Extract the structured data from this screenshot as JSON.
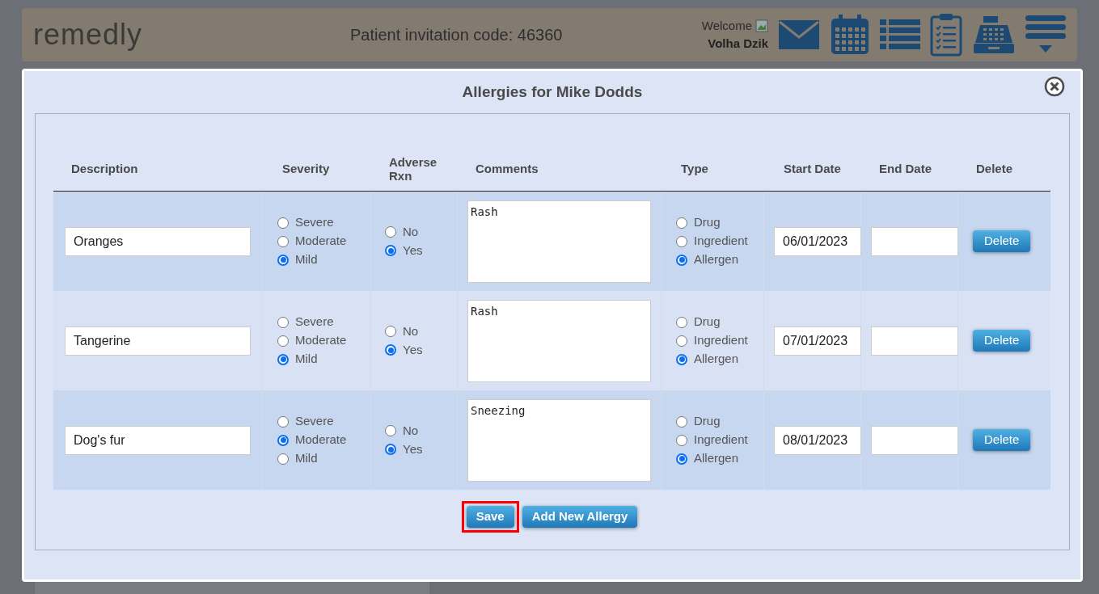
{
  "header": {
    "logo": "remedly",
    "invitation_code": "Patient invitation code: 46360",
    "welcome": "Welcome",
    "user_name": "Volha Dzik"
  },
  "modal": {
    "title": "Allergies for Mike Dodds",
    "columns": [
      "Description",
      "Severity",
      "Adverse Rxn",
      "Comments",
      "Type",
      "Start Date",
      "End Date",
      "Delete"
    ],
    "rows": [
      {
        "description": "Oranges",
        "severity": [
          {
            "label": "Severe",
            "selected": false
          },
          {
            "label": "Moderate",
            "selected": false
          },
          {
            "label": "Mild",
            "selected": true
          }
        ],
        "adverse_rxn": [
          {
            "label": "No",
            "selected": false
          },
          {
            "label": "Yes",
            "selected": true
          }
        ],
        "comments": "Rash",
        "type": [
          {
            "label": "Drug",
            "selected": false
          },
          {
            "label": "Ingredient",
            "selected": false
          },
          {
            "label": "Allergen",
            "selected": true
          }
        ],
        "start_date": "06/01/2023",
        "delete": "Delete"
      },
      {
        "description": "Tangerine",
        "severity": [
          {
            "label": "Severe",
            "selected": false
          },
          {
            "label": "Moderate",
            "selected": false
          },
          {
            "label": "Mild",
            "selected": true
          }
        ],
        "adverse_rxn": [
          {
            "label": "No",
            "selected": false
          },
          {
            "label": "Yes",
            "selected": true
          }
        ],
        "comments": "Rash",
        "type": [
          {
            "label": "Drug",
            "selected": false
          },
          {
            "label": "Ingredient",
            "selected": false
          },
          {
            "label": "Allergen",
            "selected": true
          }
        ],
        "start_date": "07/01/2023",
        "delete": "Delete"
      },
      {
        "description": "Dog's fur",
        "severity": [
          {
            "label": "Severe",
            "selected": false
          },
          {
            "label": "Moderate",
            "selected": true
          },
          {
            "label": "Mild",
            "selected": false
          }
        ],
        "adverse_rxn": [
          {
            "label": "No",
            "selected": false
          },
          {
            "label": "Yes",
            "selected": true
          }
        ],
        "comments": "Sneezing",
        "type": [
          {
            "label": "Drug",
            "selected": false
          },
          {
            "label": "Ingredient",
            "selected": false
          },
          {
            "label": "Allergen",
            "selected": true
          }
        ],
        "start_date": "08/01/2023",
        "delete": "Delete"
      }
    ],
    "buttons": [
      {
        "label": "Save",
        "highlighted": true
      },
      {
        "label": "Add New Allergy",
        "highlighted": false
      }
    ]
  }
}
